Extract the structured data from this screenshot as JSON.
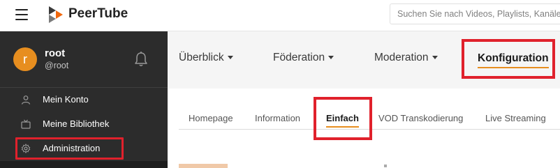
{
  "header": {
    "brand": "PeerTube",
    "search_placeholder": "Suchen Sie nach Videos, Playlists, Kanälen..."
  },
  "sidebar": {
    "user": {
      "avatar_letter": "r",
      "name": "root",
      "handle": "@root"
    },
    "items": [
      {
        "label": "Mein Konto",
        "icon": "user-icon"
      },
      {
        "label": "Meine Bibliothek",
        "icon": "tv-icon"
      },
      {
        "label": "Administration",
        "icon": "gear-icon"
      }
    ]
  },
  "topnav": {
    "items": [
      "Überblick",
      "Föderation",
      "Moderation"
    ],
    "active": "Konfiguration"
  },
  "subtabs": {
    "items": [
      "Homepage",
      "Information",
      "VOD Transkodierung",
      "Live Streaming"
    ],
    "active": "Einfach"
  },
  "colors": {
    "accent": "#e78e1f",
    "highlight": "#e0212c",
    "sidebar_bg": "#2c2c2c"
  }
}
